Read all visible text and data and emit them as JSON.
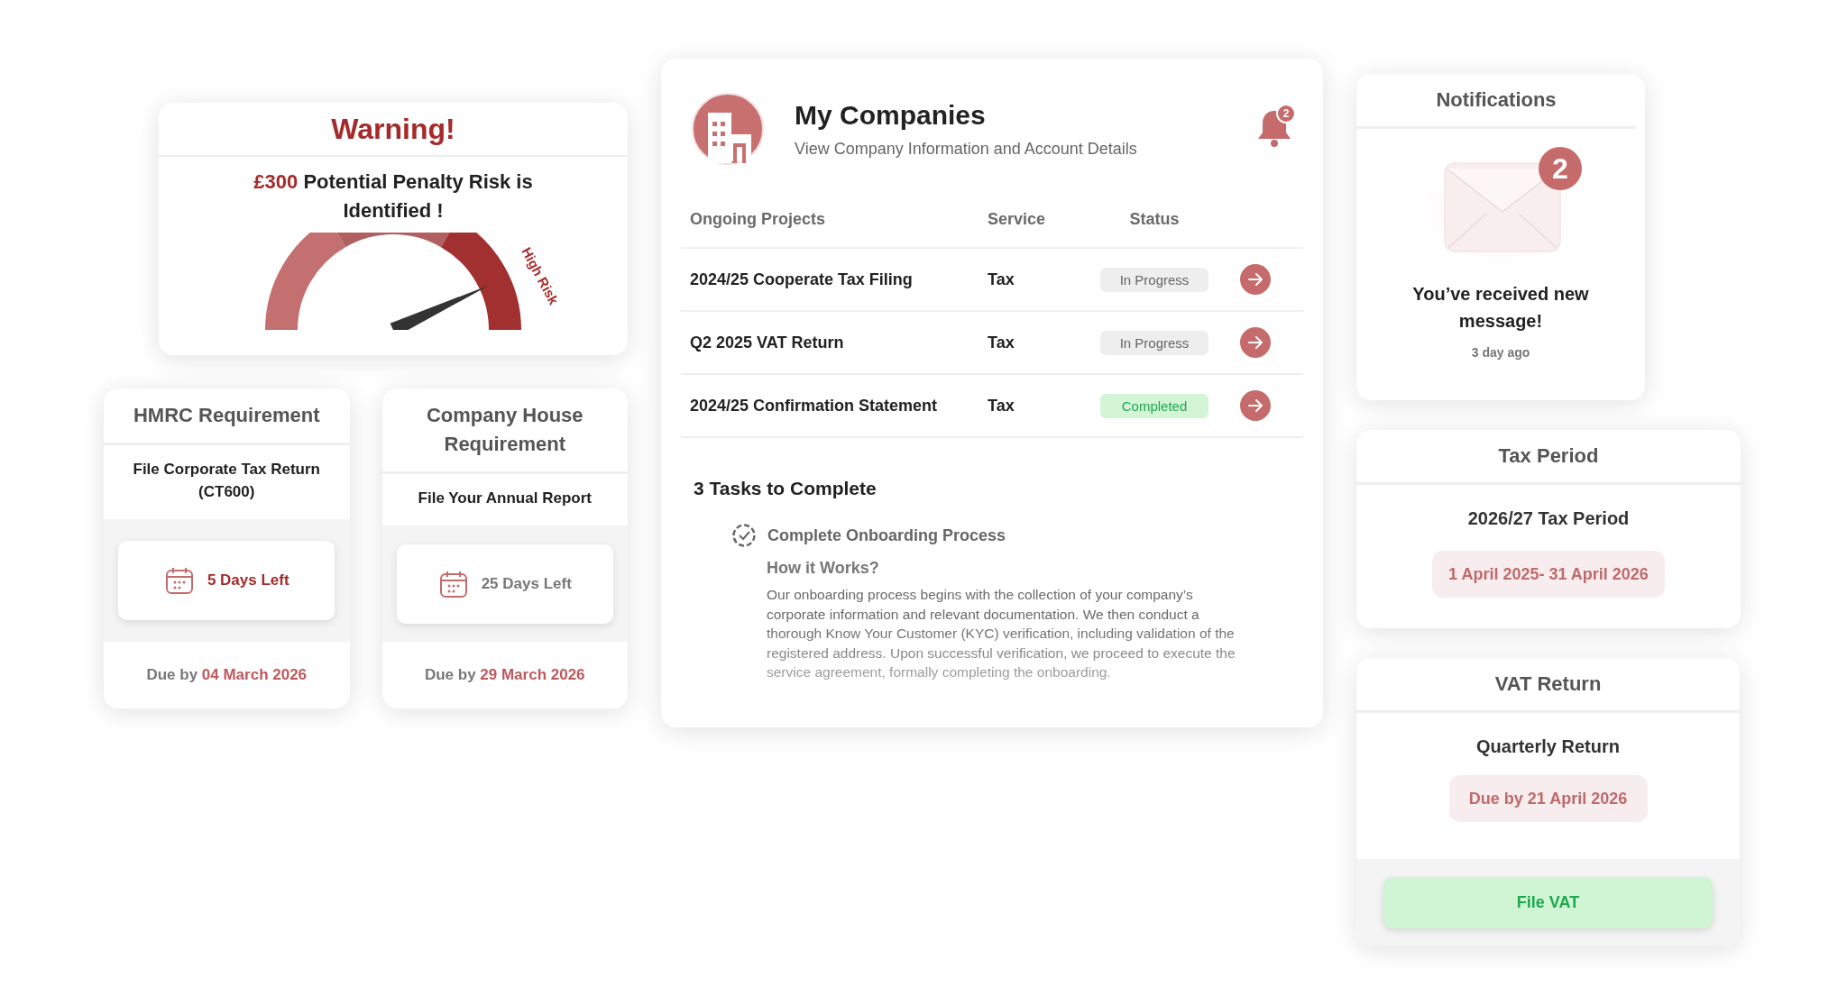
{
  "warning": {
    "title": "Warning!",
    "amount": "£300",
    "text": "Potential Penalty Risk is Identified !",
    "gauge": {
      "label": "High Risk"
    }
  },
  "requirements": [
    {
      "title": "HMRC Requirement",
      "task": "File Corporate Tax Return (CT600)",
      "days_left": "5 Days Left",
      "urgent": true,
      "due_label": "Due by",
      "due_date": "04 March 2026"
    },
    {
      "title": "Company House Requirement",
      "task": "File Your Annual Report",
      "days_left": "25 Days Left",
      "urgent": false,
      "due_label": "Due by",
      "due_date": "29 March 2026"
    }
  ],
  "companies": {
    "title": "My Companies",
    "subtitle": "View Company Information and Account Details",
    "bell_badge": "2",
    "table": {
      "columns": [
        "Ongoing Projects",
        "Service",
        "Status"
      ],
      "rows": [
        {
          "project": "2024/25 Cooperate Tax Filing",
          "service": "Tax",
          "status": "In Progress",
          "completed": false
        },
        {
          "project": "Q2 2025 VAT Return",
          "service": "Tax",
          "status": "In Progress",
          "completed": false
        },
        {
          "project": "2024/25 Confirmation Statement",
          "service": "Tax",
          "status": "Completed",
          "completed": true
        }
      ]
    },
    "tasks_title": "3 Tasks to Complete",
    "task": {
      "title": "Complete Onboarding Process",
      "subtitle": "How it Works?",
      "text": "Our onboarding process begins with the collection of your company’s corporate information and relevant documentation. We then conduct a thorough Know Your Customer (KYC) verification, including validation of the registered address. Upon successful verification, we proceed to execute the service agreement, formally completing the onboarding."
    }
  },
  "notifications": {
    "title": "Notifications",
    "badge": "2",
    "message": "You’ve received new message!",
    "time": "3 day ago"
  },
  "tax_period": {
    "title": "Tax Period",
    "period": "2026/27 Tax Period",
    "range": "1 April 2025- 31 April 2026"
  },
  "vat_return": {
    "title": "VAT Return",
    "subtitle": "Quarterly Return",
    "due": "Due by 21 April 2026",
    "button": "File VAT"
  }
}
